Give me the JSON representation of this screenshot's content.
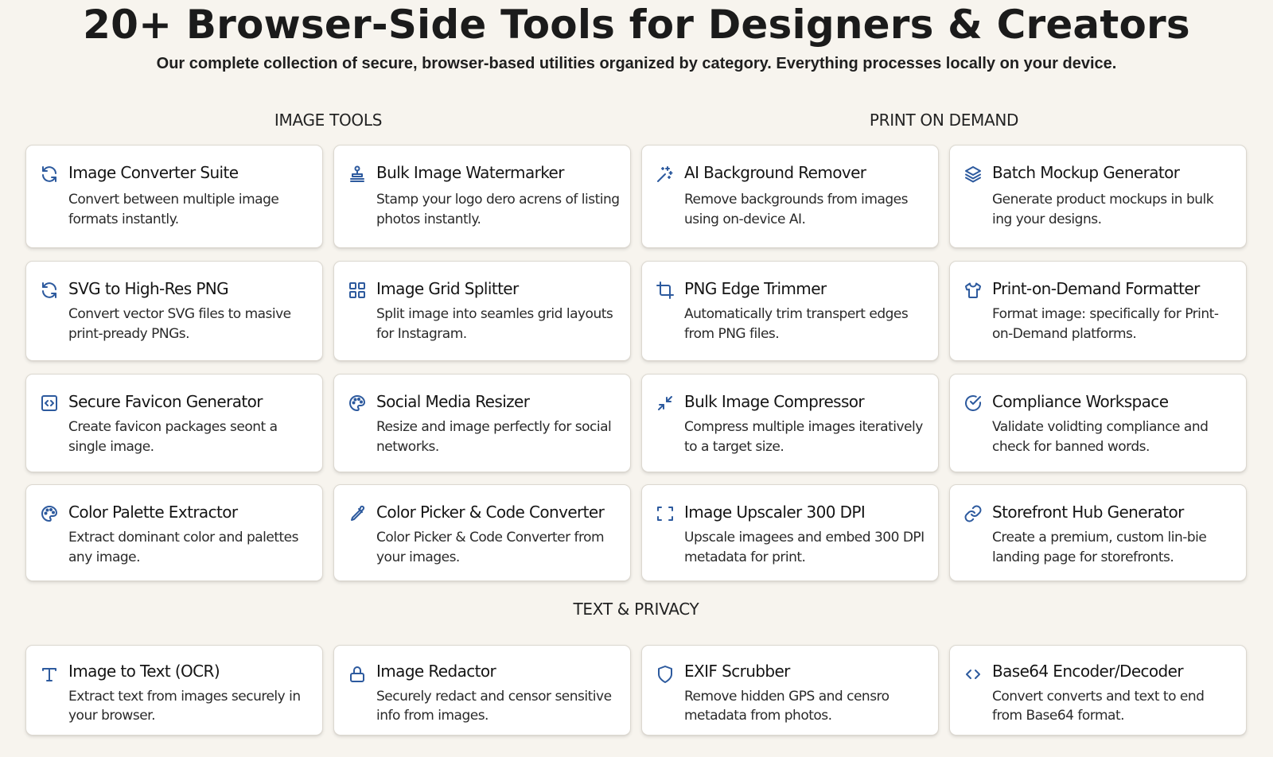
{
  "header": {
    "title": "20+ Browser-Side Tools for Designers & Creators",
    "subtitle": "Our complete collection of secure, browser-based utilities organized by category. Everything processes locally on your device."
  },
  "sections": {
    "image_tools": "IMAGE TOOLS",
    "print_on_demand": "PRINT ON DEMAND",
    "text_privacy": "TEXT & PRIVACY"
  },
  "accent_color": "#2d5a9e",
  "cards": [
    {
      "name": "Image Converter Suite",
      "desc": "Convert between multiple image formats instantly.",
      "icon": "refresh-icon"
    },
    {
      "name": "Bulk Image Watermarker",
      "desc": "Stamp your logo dero acrens of listing photos instantly.",
      "icon": "stamp-icon"
    },
    {
      "name": "AI Background Remover",
      "desc": "Remove backgrounds from images using on-device AI.",
      "icon": "sparkles-icon"
    },
    {
      "name": "Batch Mockup Generator",
      "desc": "Generate product mockups in bulk ing your designs.",
      "icon": "layers-icon"
    },
    {
      "name": "SVG to High-Res PNG",
      "desc": "Convert vector SVG files to masive print-pready PNGs.",
      "icon": "refresh-icon"
    },
    {
      "name": "Image Grid Splitter",
      "desc": "Split image into seamles grid layouts for Instagram.",
      "icon": "grid-icon"
    },
    {
      "name": "PNG Edge Trimmer",
      "desc": "Automatically trim transpert edges from PNG files.",
      "icon": "crop-icon"
    },
    {
      "name": "Print-on-Demand Formatter",
      "desc": "Format image: specifically for Print-on-Demand platforms.",
      "icon": "tshirt-icon"
    },
    {
      "name": "Secure Favicon Generator",
      "desc": "Create favicon packages seont a single image.",
      "icon": "code-square-icon"
    },
    {
      "name": "Social Media Resizer",
      "desc": "Resize and image perfectly for social networks.",
      "icon": "palette-icon"
    },
    {
      "name": "Bulk Image Compressor",
      "desc": "Compress multiple images iteratively to a target size.",
      "icon": "compress-icon"
    },
    {
      "name": "Compliance Workspace",
      "desc": "Validate volidting compliance and check for banned words.",
      "icon": "check-circle-icon"
    },
    {
      "name": "Color Palette Extractor",
      "desc": "Extract dominant color and palettes any image.",
      "icon": "palette-icon"
    },
    {
      "name": "Color Picker & Code Converter",
      "desc": "Color Picker & Code Converter from your images.",
      "icon": "eyedropper-icon"
    },
    {
      "name": "Image Upscaler 300 DPI",
      "desc": "Upscale imagees and embed 300 DPI metadata for print.",
      "icon": "expand-icon"
    },
    {
      "name": "Storefront Hub Generator",
      "desc": "Create a premium, custom lin-bie landing page for storefronts.",
      "icon": "link-icon"
    },
    {
      "name": "Image to Text (OCR)",
      "desc": "Extract text from images securely in your browser.",
      "icon": "text-icon"
    },
    {
      "name": "Image Redactor",
      "desc": "Securely redact and censor sensitive info from images.",
      "icon": "lock-icon"
    },
    {
      "name": "EXIF Scrubber",
      "desc": "Remove hidden GPS and censro metadata from photos.",
      "icon": "shield-icon"
    },
    {
      "name": "Base64 Encoder/Decoder",
      "desc": "Convert converts and text to end from Base64 format.",
      "icon": "code-icon"
    }
  ]
}
